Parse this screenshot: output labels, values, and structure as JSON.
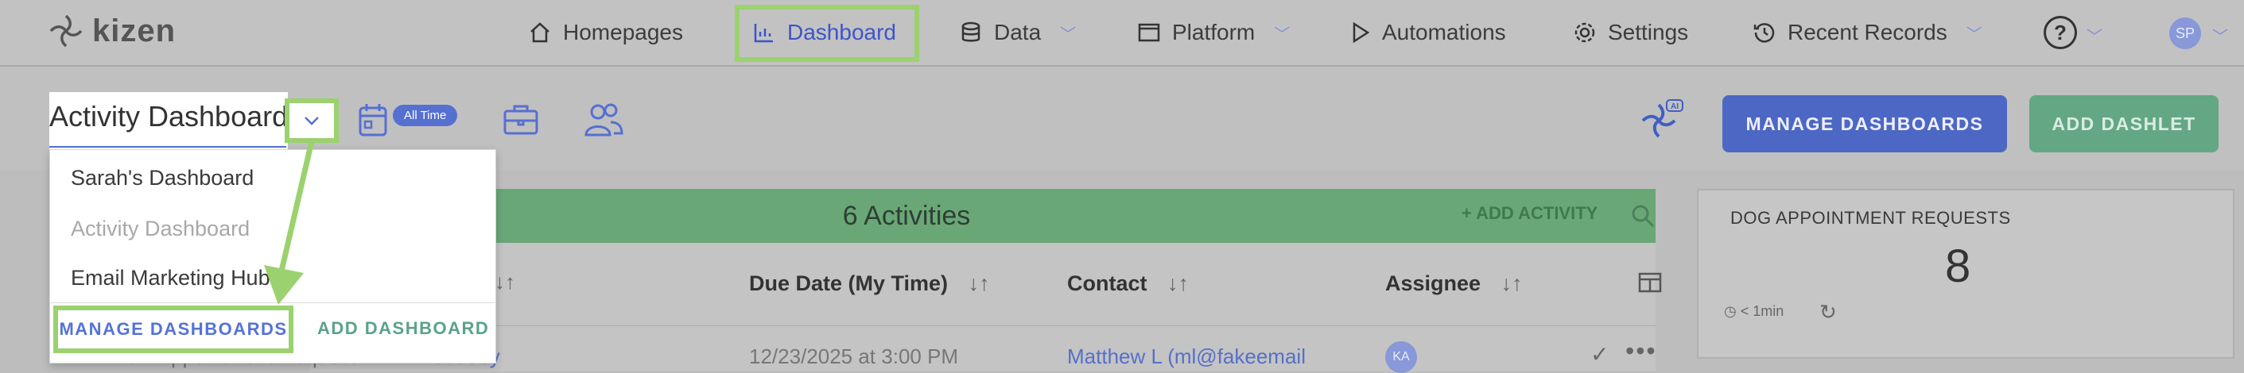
{
  "nav": {
    "brand": "kizen",
    "items": [
      {
        "label": "Homepages",
        "icon": "home-icon"
      },
      {
        "label": "Dashboard",
        "icon": "bar-chart-icon"
      },
      {
        "label": "Data",
        "icon": "database-icon"
      },
      {
        "label": "Platform",
        "icon": "window-icon"
      },
      {
        "label": "Automations",
        "icon": "play-icon"
      },
      {
        "label": "Settings",
        "icon": "gear-icon"
      },
      {
        "label": "Recent Records",
        "icon": "history-icon"
      }
    ],
    "help": "?",
    "avatar": "SP"
  },
  "toolbar": {
    "dashboard_select_value": "Activity Dashboard",
    "date_badge": "All Time",
    "manage_button": "MANAGE DASHBOARDS",
    "add_dashlet_button": "ADD DASHLET"
  },
  "dropdown": {
    "options": [
      "Sarah's Dashboard",
      "Activity Dashboard",
      "Email Marketing Hub"
    ],
    "manage": "MANAGE DASHBOARDS",
    "add": "ADD DASHBOARD"
  },
  "activities": {
    "title": "6 Activities",
    "add_label": "+ ADD ACTIVITY",
    "columns": [
      "Due Date (My Time)",
      "Contact",
      "Assignee"
    ],
    "row": {
      "name": "New Appointment Request",
      "pet": "Scooby",
      "due": "12/23/2025 at 3:00 PM",
      "contact": "Matthew L (ml@fakeemail",
      "assignee": "KA"
    }
  },
  "card": {
    "title": "DOG APPOINTMENT REQUESTS",
    "count": "8",
    "refresh": "< 1min"
  },
  "colors": {
    "highlight": "#9bd16e",
    "primary": "#4c68c4",
    "green": "#64a785"
  }
}
